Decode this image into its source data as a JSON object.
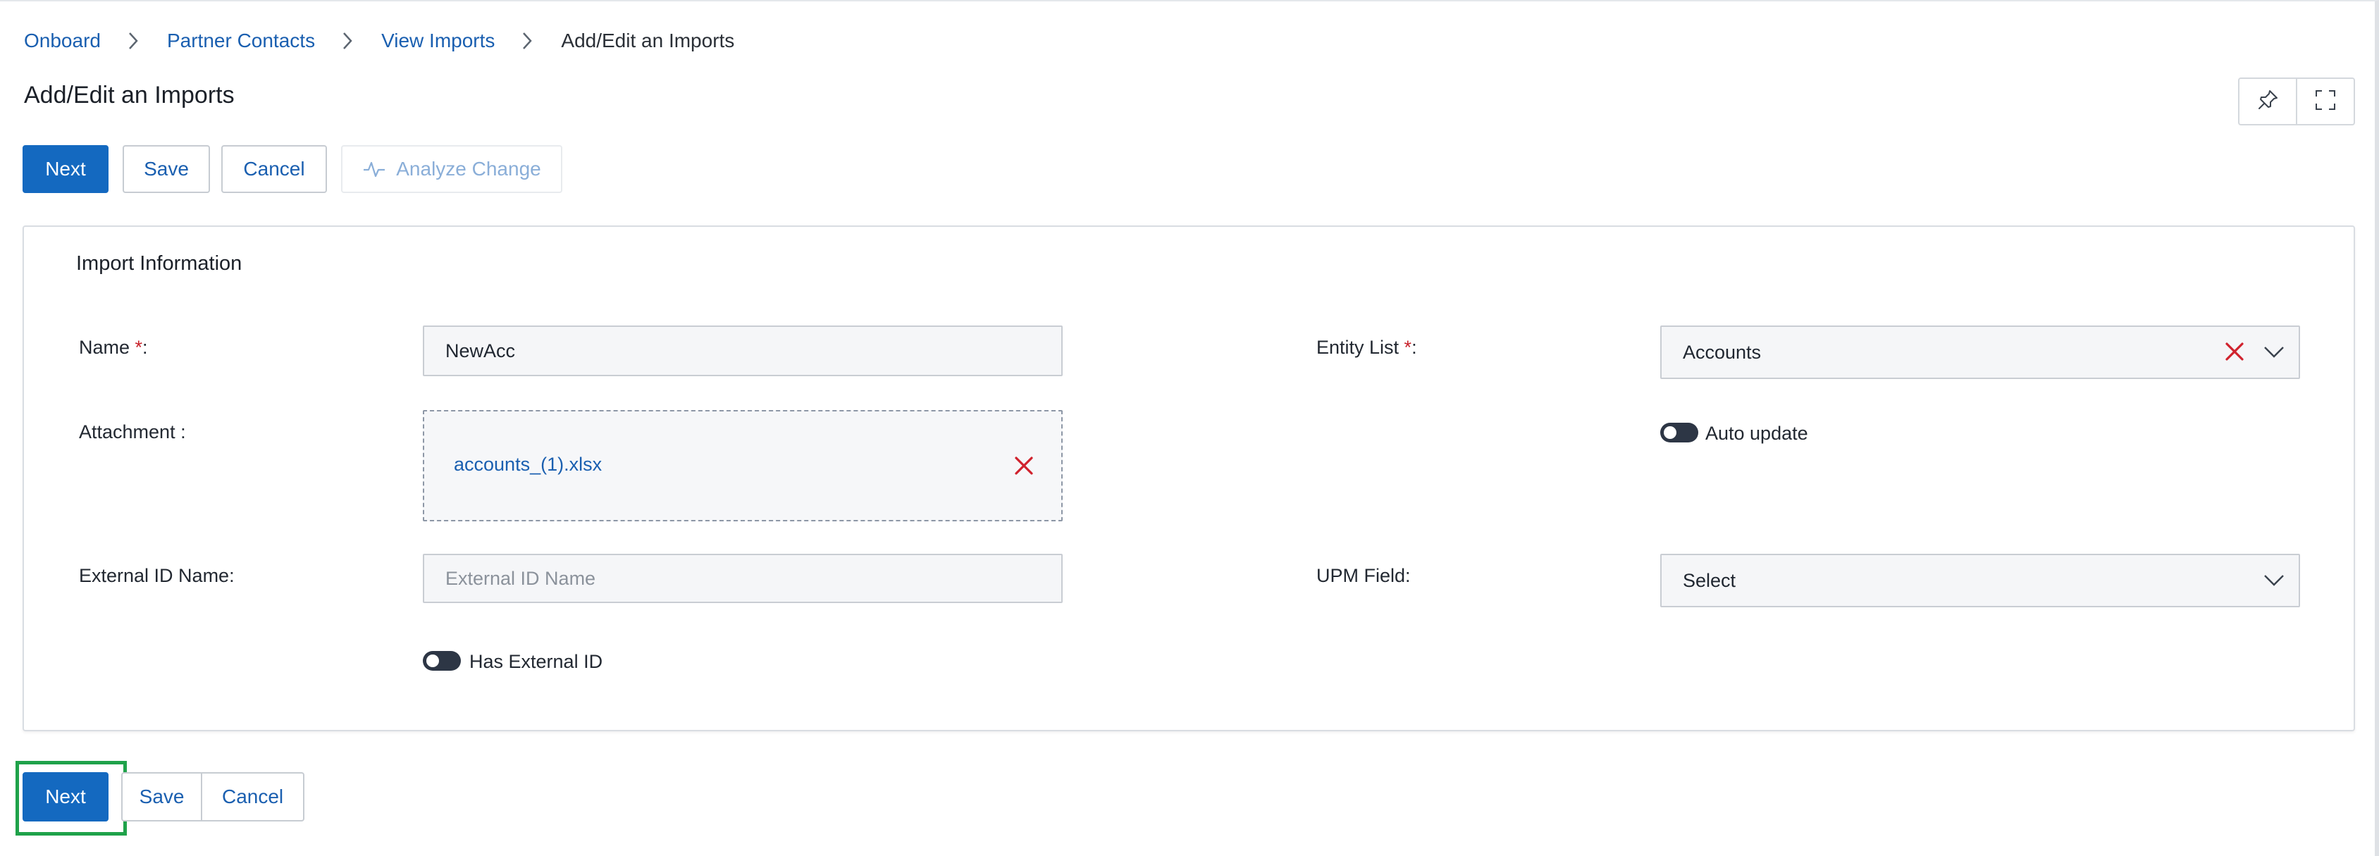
{
  "breadcrumb": {
    "items": [
      "Onboard",
      "Partner Contacts",
      "View Imports"
    ],
    "current": "Add/Edit an Imports"
  },
  "page_title": "Add/Edit an Imports",
  "toolbar": {
    "next_label": "Next",
    "save_label": "Save",
    "cancel_label": "Cancel",
    "analyze_label": "Analyze Change"
  },
  "view_controls": {
    "pin_icon": "pin-icon",
    "fullscreen_icon": "fullscreen-icon"
  },
  "form": {
    "section_title": "Import Information",
    "name": {
      "label": "Name ",
      "required_mark": "*",
      "suffix": ":",
      "value": "NewAcc"
    },
    "attachment": {
      "label": "Attachment :",
      "file_name": "accounts_(1).xlsx"
    },
    "external_id_name": {
      "label": "External ID Name:",
      "value": "",
      "placeholder": "External ID Name"
    },
    "has_external_id": {
      "label": "Has External ID",
      "enabled": false
    },
    "entity_list": {
      "label": "Entity List ",
      "required_mark": "*",
      "suffix": ":",
      "value": "Accounts"
    },
    "auto_update": {
      "label": "Auto update",
      "enabled": false
    },
    "upm_field": {
      "label": "UPM Field:",
      "value": "Select"
    }
  },
  "footer": {
    "next_label": "Next",
    "save_label": "Save",
    "cancel_label": "Cancel"
  },
  "colors": {
    "primary": "#1469c0",
    "link": "#1a5fb0",
    "danger": "#d0222d",
    "highlight": "#1fa24a"
  }
}
